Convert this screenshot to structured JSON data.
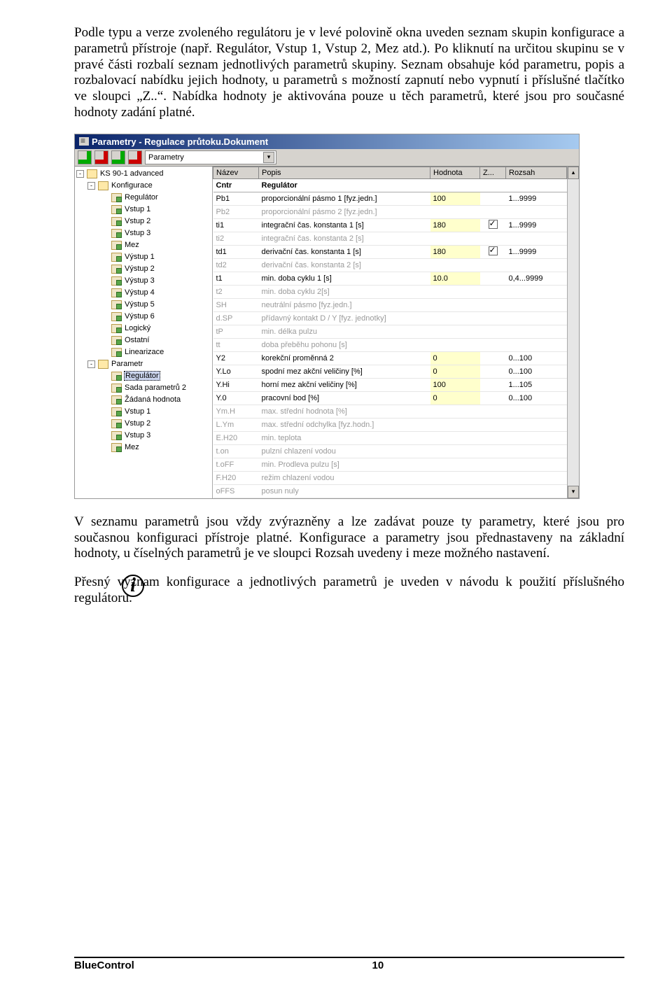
{
  "paragraphs": {
    "p1": "Podle typu a verze zvoleného regulátoru je v levé polovině okna uveden seznam skupin konfigurace a parametrů přístroje (např. Regulátor, Vstup 1, Vstup 2, Mez atd.). Po kliknutí na určitou skupinu se v pravé části rozbalí seznam jednotlivých parametrů skupiny. Seznam obsahuje kód parametru, popis a rozbalovací nabídku jejich hodnoty, u parametrů s možností zapnutí nebo vypnutí i příslušné tlačítko ve sloupci „Z..“. Nabídka hodnoty je aktivována pouze u těch parametrů, které jsou pro současné hodnoty zadání platné.",
    "p2": "V seznamu parametrů jsou vždy zvýrazněny a lze zadávat pouze ty parametry, které jsou pro současnou konfiguraci přístroje platné. Konfigurace a parametry jsou přednastaveny na základní hodnoty, u číselných parametrů je ve sloupci Rozsah uvedeny i meze možného nastavení.",
    "p3": "Přesný význam konfigurace a jednotlivých parametrů je uveden v návodu k použití příslušného regulátoru."
  },
  "window": {
    "title": "Parametry - Regulace průtoku.Dokument",
    "dropdown": "Parametry"
  },
  "tree": [
    {
      "lvl": 0,
      "exp": "-",
      "icon": "box",
      "label": "KS 90-1 advanced"
    },
    {
      "lvl": 1,
      "exp": "-",
      "icon": "box",
      "label": "Konfigurace"
    },
    {
      "lvl": 2,
      "icon": "leaf",
      "label": "Regulátor"
    },
    {
      "lvl": 2,
      "icon": "leaf",
      "label": "Vstup 1"
    },
    {
      "lvl": 2,
      "icon": "leaf",
      "label": "Vstup 2"
    },
    {
      "lvl": 2,
      "icon": "leaf",
      "label": "Vstup 3"
    },
    {
      "lvl": 2,
      "icon": "leaf",
      "label": "Mez"
    },
    {
      "lvl": 2,
      "icon": "leaf",
      "label": "Výstup 1"
    },
    {
      "lvl": 2,
      "icon": "leaf",
      "label": "Výstup 2"
    },
    {
      "lvl": 2,
      "icon": "leaf",
      "label": "Výstup 3"
    },
    {
      "lvl": 2,
      "icon": "leaf",
      "label": "Výstup 4"
    },
    {
      "lvl": 2,
      "icon": "leaf",
      "label": "Výstup 5"
    },
    {
      "lvl": 2,
      "icon": "leaf",
      "label": "Výstup 6"
    },
    {
      "lvl": 2,
      "icon": "leaf",
      "label": "Logický"
    },
    {
      "lvl": 2,
      "icon": "leaf",
      "label": "Ostatní"
    },
    {
      "lvl": 2,
      "icon": "leaf",
      "label": "Linearizace"
    },
    {
      "lvl": 1,
      "exp": "-",
      "icon": "box",
      "label": "Parametr"
    },
    {
      "lvl": 2,
      "icon": "leaf",
      "label": "Regulátor",
      "sel": true
    },
    {
      "lvl": 2,
      "icon": "leaf",
      "label": "Sada parametrů 2"
    },
    {
      "lvl": 2,
      "icon": "leaf",
      "label": "Žádaná hodnota"
    },
    {
      "lvl": 2,
      "icon": "leaf",
      "label": "Vstup 1"
    },
    {
      "lvl": 2,
      "icon": "leaf",
      "label": "Vstup 2"
    },
    {
      "lvl": 2,
      "icon": "leaf",
      "label": "Vstup 3"
    },
    {
      "lvl": 2,
      "icon": "leaf",
      "label": "Mez"
    }
  ],
  "columns": {
    "name": "Název",
    "popis": "Popis",
    "hodnota": "Hodnota",
    "z": "Z...",
    "rozsah": "Rozsah"
  },
  "header_row": {
    "name": "Cntr",
    "popis": "Regulátor"
  },
  "rows": [
    {
      "name": "Pb1",
      "popis": "proporcionální pásmo 1 [fyz.jedn.]",
      "hodnota": "100",
      "z": "",
      "rozsah": "1...9999",
      "dis": false
    },
    {
      "name": "Pb2",
      "popis": "proporcionální pásmo 2 [fyz.jedn.]",
      "hodnota": "",
      "z": "",
      "rozsah": "",
      "dis": true
    },
    {
      "name": "ti1",
      "popis": "integrační čas. konstanta 1 [s]",
      "hodnota": "180",
      "z": "ck",
      "rozsah": "1...9999",
      "dis": false
    },
    {
      "name": "ti2",
      "popis": "integrační čas. konstanta 2 [s]",
      "hodnota": "",
      "z": "",
      "rozsah": "",
      "dis": true
    },
    {
      "name": "td1",
      "popis": "derivační čas. konstanta 1 [s]",
      "hodnota": "180",
      "z": "ck",
      "rozsah": "1...9999",
      "dis": false
    },
    {
      "name": "td2",
      "popis": "derivační čas. konstanta 2 [s]",
      "hodnota": "",
      "z": "",
      "rozsah": "",
      "dis": true
    },
    {
      "name": "t1",
      "popis": "min. doba cyklu 1 [s]",
      "hodnota": "10.0",
      "z": "",
      "rozsah": "0,4...9999",
      "dis": false
    },
    {
      "name": "t2",
      "popis": "min. doba cyklu 2[s]",
      "hodnota": "",
      "z": "",
      "rozsah": "",
      "dis": true
    },
    {
      "name": "SH",
      "popis": "neutrální pásmo [fyz.jedn.]",
      "hodnota": "",
      "z": "",
      "rozsah": "",
      "dis": true
    },
    {
      "name": "d.SP",
      "popis": "přídavný kontakt D / Y [fyz. jednotky]",
      "hodnota": "",
      "z": "",
      "rozsah": "",
      "dis": true
    },
    {
      "name": "tP",
      "popis": "min. délka pulzu",
      "hodnota": "",
      "z": "",
      "rozsah": "",
      "dis": true
    },
    {
      "name": "tt",
      "popis": "doba přeběhu pohonu [s]",
      "hodnota": "",
      "z": "",
      "rozsah": "",
      "dis": true
    },
    {
      "name": "Y2",
      "popis": "korekční proměnná 2",
      "hodnota": "0",
      "z": "",
      "rozsah": "0...100",
      "dis": false
    },
    {
      "name": "Y.Lo",
      "popis": "spodní mez akční veličiny [%]",
      "hodnota": "0",
      "z": "",
      "rozsah": "0...100",
      "dis": false
    },
    {
      "name": "Y.Hi",
      "popis": "horní mez akční veličiny [%]",
      "hodnota": "100",
      "z": "",
      "rozsah": "1...105",
      "dis": false
    },
    {
      "name": "Y.0",
      "popis": "pracovní bod [%]",
      "hodnota": "0",
      "z": "",
      "rozsah": "0...100",
      "dis": false
    },
    {
      "name": "Ym.H",
      "popis": "max. střední hodnota [%]",
      "hodnota": "",
      "z": "",
      "rozsah": "",
      "dis": true
    },
    {
      "name": "L.Ym",
      "popis": "max. střední odchylka [fyz.hodn.]",
      "hodnota": "",
      "z": "",
      "rozsah": "",
      "dis": true
    },
    {
      "name": "E.H20",
      "popis": "min. teplota",
      "hodnota": "",
      "z": "",
      "rozsah": "",
      "dis": true
    },
    {
      "name": "t.on",
      "popis": "pulzní chlazení vodou",
      "hodnota": "",
      "z": "",
      "rozsah": "",
      "dis": true
    },
    {
      "name": "t.oFF",
      "popis": "min. Prodleva pulzu [s]",
      "hodnota": "",
      "z": "",
      "rozsah": "",
      "dis": true
    },
    {
      "name": "F.H20",
      "popis": "režim chlazení vodou",
      "hodnota": "",
      "z": "",
      "rozsah": "",
      "dis": true
    },
    {
      "name": "oFFS",
      "popis": "posun nuly",
      "hodnota": "",
      "z": "",
      "rozsah": "",
      "dis": true
    }
  ],
  "footer": {
    "product": "BlueControl",
    "page": "10"
  }
}
